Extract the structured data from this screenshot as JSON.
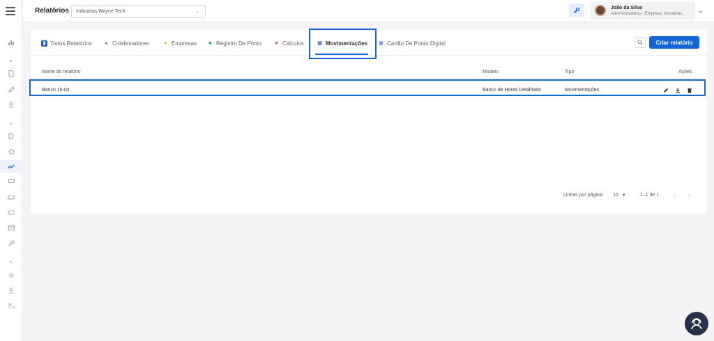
{
  "header": {
    "title": "Relatórios",
    "company_select": "Industrias Wayne Tech",
    "user_name": "João da Silva",
    "user_role": "Administradores - Empresa: Industrias..."
  },
  "tabs": [
    {
      "label": "Todos Relatórios",
      "icon": "chart-icon",
      "color": "#1565d8"
    },
    {
      "label": "Colaboradores",
      "icon": "users-icon",
      "color": "#4a7bd0"
    },
    {
      "label": "Empresas",
      "icon": "building-icon",
      "color": "#e2b33a"
    },
    {
      "label": "Registro De Ponto",
      "icon": "clock-register-icon",
      "color": "#3aa757"
    },
    {
      "label": "Cálculos",
      "icon": "calculator-icon",
      "color": "#e05a5a"
    },
    {
      "label": "Movimentações",
      "icon": "transfer-icon",
      "color": "#5b78c4"
    },
    {
      "label": "Cartão De Ponto Digital",
      "icon": "card-icon",
      "color": "#3b6fd6"
    }
  ],
  "buttons": {
    "create": "Criar relatório"
  },
  "table": {
    "headers": {
      "name": "Nome do relatório",
      "model": "Modelo",
      "type": "Tipo",
      "actions": "Ações"
    },
    "rows": [
      {
        "name": "Banco 10-04",
        "model": "Banco de Horas Detalhado",
        "type": "Movimentações"
      }
    ]
  },
  "pagination": {
    "rows_label": "Linhas por página:",
    "rows_value": "10",
    "range": "1–1 de 1"
  },
  "colors": {
    "accent": "#1565d8"
  }
}
